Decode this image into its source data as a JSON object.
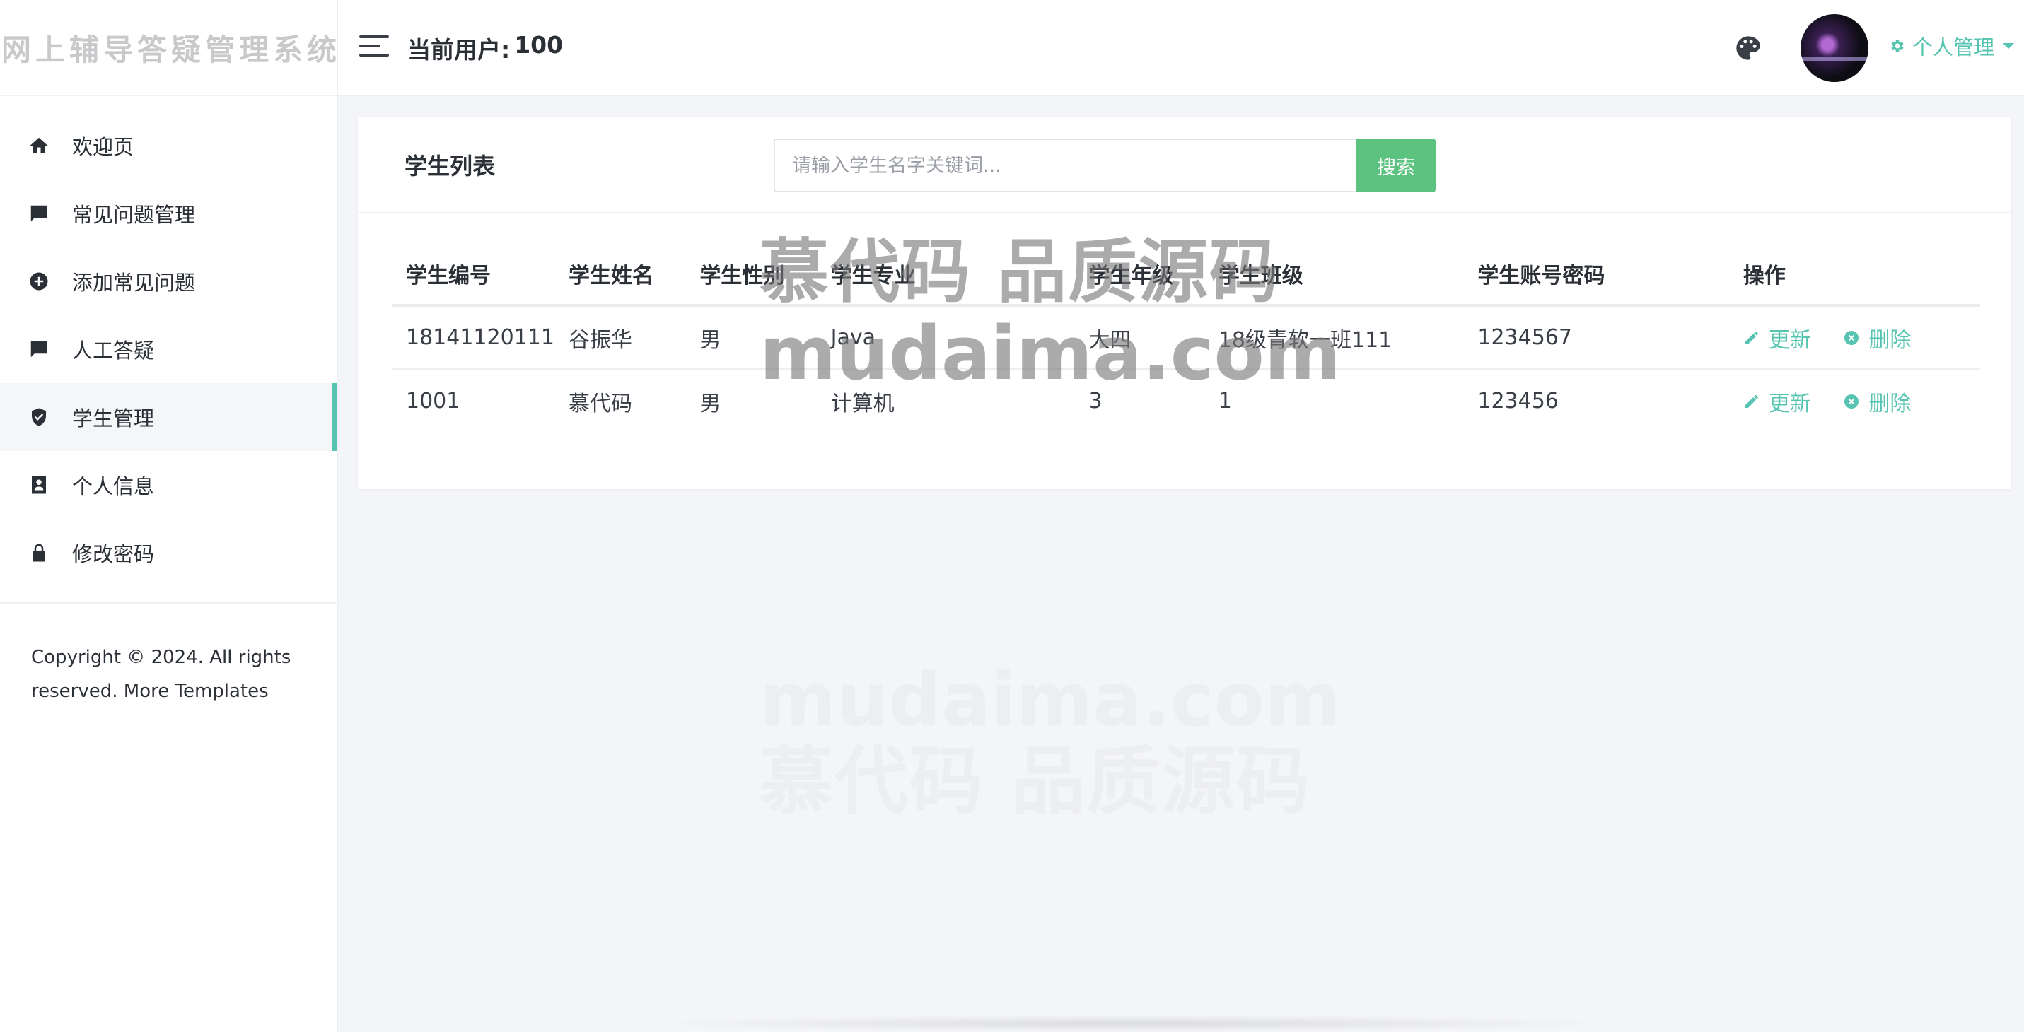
{
  "brand": {
    "title": "网上辅导答疑管理系统"
  },
  "header": {
    "current_user_label": "当前用户:",
    "current_user_value": "100",
    "personal_menu_label": "个人管理"
  },
  "sidebar": {
    "items": [
      {
        "label": "欢迎页",
        "icon": "home-icon",
        "active": false
      },
      {
        "label": "常见问题管理",
        "icon": "chat-icon",
        "active": false
      },
      {
        "label": "添加常见问题",
        "icon": "plus-circle-icon",
        "active": false
      },
      {
        "label": "人工答疑",
        "icon": "feedback-icon",
        "active": false
      },
      {
        "label": "学生管理",
        "icon": "shield-check-icon",
        "active": true
      },
      {
        "label": "个人信息",
        "icon": "contact-card-icon",
        "active": false
      },
      {
        "label": "修改密码",
        "icon": "lock-icon",
        "active": false
      }
    ],
    "copyright": "Copyright © 2024. All rights reserved. More Templates"
  },
  "main": {
    "card_title": "学生列表",
    "search": {
      "placeholder": "请输入学生名字关键词...",
      "value": "",
      "button_label": "搜索"
    },
    "table": {
      "columns": [
        "学生编号",
        "学生姓名",
        "学生性别",
        "学生专业",
        "学生年级",
        "学生班级",
        "学生账号密码",
        "操作"
      ],
      "rows": [
        [
          "18141120111",
          "谷振华",
          "男",
          "Java",
          "大四",
          "18级青软一班111",
          "1234567"
        ],
        [
          "1001",
          "慕代码",
          "男",
          "计算机",
          "3",
          "1",
          "123456"
        ]
      ],
      "actions": {
        "update_label": "更新",
        "delete_label": "删除"
      }
    }
  },
  "watermark": {
    "line1": "慕代码 品质源码",
    "line2": "mudaima.com"
  },
  "colors": {
    "accent": "#57c4b1",
    "search_button": "#5cc27f",
    "background": "#f4f5f9"
  }
}
